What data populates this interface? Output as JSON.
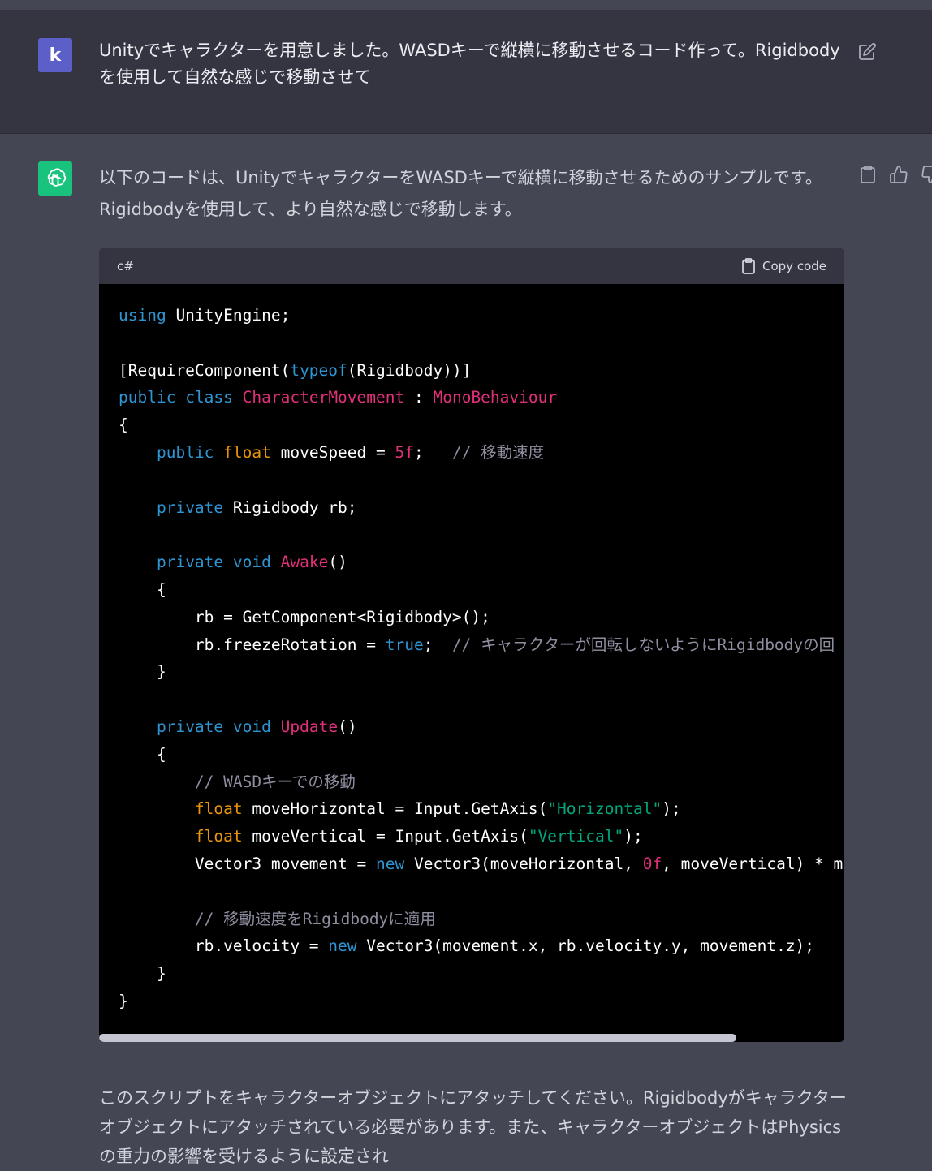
{
  "user_message": {
    "avatar_letter": "k",
    "text": "Unityでキャラクターを用意しました。WASDキーで縦横に移動させるコード作って。Rigidbodyを使用して自然な感じで移動させて",
    "edit_icon": "edit-icon"
  },
  "assistant_message": {
    "avatar_icon": "openai-logo-icon",
    "intro": "以下のコードは、UnityでキャラクターをWASDキーで縦横に移動させるためのサンプルです。Rigidbodyを使用して、より自然な感じで移動します。",
    "actions": [
      "copy-icon",
      "thumbs-up-icon",
      "thumbs-down-icon"
    ],
    "code_block": {
      "language": "c#",
      "copy_label": "Copy code",
      "lines": [
        "using UnityEngine;",
        "",
        "[RequireComponent(typeof(Rigidbody))]",
        "public class CharacterMovement : MonoBehaviour",
        "{",
        "    public float moveSpeed = 5f;   // 移動速度",
        "",
        "    private Rigidbody rb;",
        "",
        "    private void Awake()",
        "    {",
        "        rb = GetComponent<Rigidbody>();",
        "        rb.freezeRotation = true;  // キャラクターが回転しないようにRigidbodyの回",
        "    }",
        "",
        "    private void Update()",
        "    {",
        "        // WASDキーでの移動",
        "        float moveHorizontal = Input.GetAxis(\"Horizontal\");",
        "        float moveVertical = Input.GetAxis(\"Vertical\");",
        "        Vector3 movement = new Vector3(moveHorizontal, 0f, moveVertical) * m",
        "",
        "        // 移動速度をRigidbodyに適用",
        "        rb.velocity = new Vector3(movement.x, rb.velocity.y, movement.z);",
        "    }",
        "}"
      ],
      "scroll_position": 0.855
    },
    "outro": "このスクリプトをキャラクターオブジェクトにアタッチしてください。Rigidbodyがキャラクターオブジェクトにアタッチされている必要があります。また、キャラクターオブジェクトはPhysicsの重力の影響を受けるように設定され"
  },
  "colors": {
    "background_assistant": "#444654",
    "background_user": "#343541",
    "code_background": "#000000",
    "keyword": "#2e95d3",
    "type": "#df3079",
    "float_keyword": "#e9950c",
    "string": "#00a67d",
    "comment": "#8e8ea0",
    "gpt_avatar": "#19c37d",
    "user_avatar": "#5b5fc7"
  }
}
